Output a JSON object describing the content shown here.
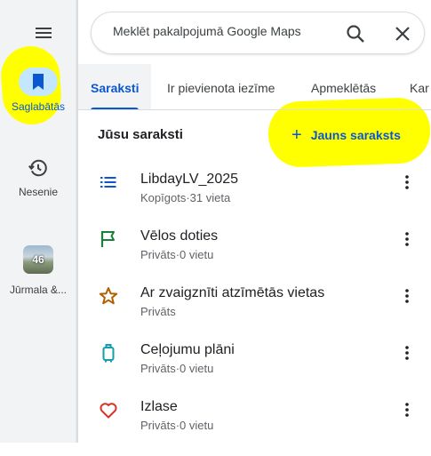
{
  "sidebar": {
    "saved_label": "Saglabātās",
    "recent_label": "Nesenie",
    "recent_place": {
      "count": "46",
      "label": "Jūrmala &..."
    }
  },
  "search": {
    "placeholder": "Meklēt pakalpojumā Google Maps"
  },
  "tabs": [
    {
      "label": "Saraksti",
      "active": true
    },
    {
      "label": "Ir pievienota iezīme",
      "active": false
    },
    {
      "label": "Apmeklētās",
      "active": false
    },
    {
      "label": "Kar",
      "active": false
    }
  ],
  "lists_header": {
    "title": "Jūsu saraksti",
    "new_list_label": "Jauns saraksts"
  },
  "lists": [
    {
      "title": "LibdayLV_2025",
      "subtitle": "Kopīgots·31 vieta",
      "icon": "list-icon"
    },
    {
      "title": "Vēlos doties",
      "subtitle": "Privāts·0 vietu",
      "icon": "flag-icon"
    },
    {
      "title": "Ar zvaigznīti atzīmētās vietas",
      "subtitle": "Privāts",
      "icon": "star-icon"
    },
    {
      "title": "Ceļojumu plāni",
      "subtitle": "Privāts·0 vietu",
      "icon": "luggage-icon"
    },
    {
      "title": "Izlase",
      "subtitle": "Privāts·0 vietu",
      "icon": "heart-icon"
    }
  ],
  "colors": {
    "accent": "#0b57d0",
    "flag": "#188038",
    "star": "#b06000",
    "luggage": "#129eaf",
    "heart": "#d93025",
    "highlight": "#ffff00"
  }
}
